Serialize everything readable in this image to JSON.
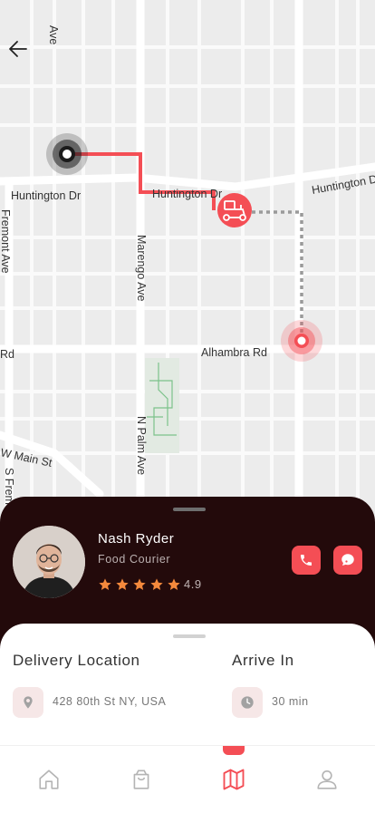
{
  "map": {
    "streets": {
      "huntington_left": "Huntington Dr",
      "huntington_mid": "Huntington Dr",
      "huntington_right": "Huntington Dr",
      "fremont": "Fremont Ave",
      "marengo": "Marengo Ave",
      "alhambra": "Alhambra Rd",
      "rd_left": "Rd",
      "w_main": "W Main St",
      "palm": "N Palm Ave",
      "s_fremont": "S Frem",
      "top_ave": "Ave"
    },
    "colors": {
      "route": "#f44e55",
      "origin": "#1b1b1b",
      "destination": "#f44e55"
    }
  },
  "courier": {
    "name": "Nash Ryder",
    "role": "Food Courier",
    "rating": "4.9",
    "stars": 5,
    "star_color": "#f4893c"
  },
  "delivery": {
    "location_title": "Delivery Location",
    "location_value": "428 80th St NY, USA",
    "arrive_title": "Arrive In",
    "arrive_value": "30 min"
  },
  "nav": {
    "items": [
      "home-icon",
      "bag-icon",
      "map-icon",
      "profile-icon"
    ],
    "active": "map-icon",
    "accent": "#f44e55"
  }
}
